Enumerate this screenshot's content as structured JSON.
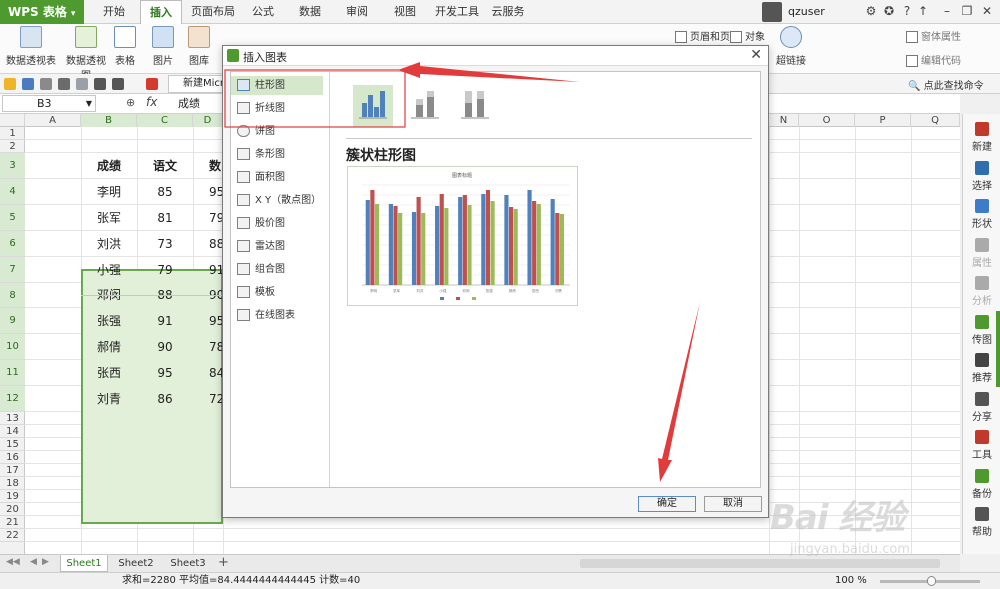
{
  "app": {
    "title": "WPS 表格",
    "user": "qzuser"
  },
  "menu": {
    "tabs": [
      "开始",
      "插入",
      "页面布局",
      "公式",
      "数据",
      "审阅",
      "视图",
      "开发工具",
      "云服务"
    ],
    "active_tab": "插入"
  },
  "ribbon": {
    "items": [
      "数据透视表",
      "数据透视图",
      "表格",
      "图片",
      "图库",
      "超链接"
    ],
    "right_items": [
      "页眉和页脚",
      "对象",
      "窗体属性",
      "编辑代码"
    ]
  },
  "quickbar": {
    "doc_tab": "新建Micro",
    "find_label": "点此查找命令"
  },
  "formula": {
    "cell_ref": "B3",
    "fx": "fx",
    "value": "成绩"
  },
  "sheet": {
    "columns": [
      "A",
      "B",
      "C",
      "D",
      "N",
      "O",
      "P",
      "Q"
    ],
    "rows": [
      "1",
      "2",
      "3",
      "4",
      "5",
      "6",
      "7",
      "8",
      "9",
      "10",
      "11",
      "12",
      "13",
      "14",
      "15",
      "16",
      "17",
      "18",
      "19",
      "20",
      "21",
      "22"
    ],
    "header_row": [
      "成绩",
      "语文",
      "数学"
    ],
    "names": [
      "李明",
      "张军",
      "刘洪",
      "小强",
      "邓闵",
      "张强",
      "郝倩",
      "张西",
      "刘青"
    ],
    "chinese": [
      "85",
      "81",
      "73",
      "79",
      "88",
      "91",
      "90",
      "95",
      "86"
    ],
    "math_partial": [
      "95",
      "79",
      "88",
      "91",
      "90",
      "95",
      "78",
      "84",
      "72"
    ]
  },
  "sheet_tabs": {
    "tabs": [
      "Sheet1",
      "Sheet2",
      "Sheet3"
    ],
    "active": "Sheet1",
    "add": "+"
  },
  "status": {
    "text": "求和=2280  平均值=84.4444444444445  计数=40",
    "zoom": "100 %"
  },
  "sidebar": {
    "items": [
      "新建",
      "选择",
      "形状",
      "属性",
      "分析",
      "传图",
      "推荐",
      "分享",
      "工具",
      "备份",
      "帮助"
    ]
  },
  "dialog": {
    "title": "插入图表",
    "close": "✕",
    "chart_types": [
      "柱形图",
      "折线图",
      "饼图",
      "条形图",
      "面积图",
      "X Y（散点图）",
      "股价图",
      "雷达图",
      "组合图",
      "模板",
      "在线图表"
    ],
    "active_type": "柱形图",
    "subtype_name": "簇状柱形图",
    "preview_title": "图表标题",
    "preview_categories": [
      "李明",
      "张军",
      "刘洪",
      "小强",
      "邓闵",
      "张强",
      "郝倩",
      "张西",
      "刘青"
    ],
    "ok": "确定",
    "cancel": "取消"
  },
  "watermark": {
    "brand": "Bai 经验",
    "sub": "jingyan.baidu.com"
  },
  "colors": {
    "accent_green": "#4e9a2f",
    "selection_fill": "#e2f0d9",
    "arrow_red": "#e23b3b",
    "series1": "#4f81bd",
    "series2": "#c0504d",
    "series3": "#9bbb59"
  }
}
